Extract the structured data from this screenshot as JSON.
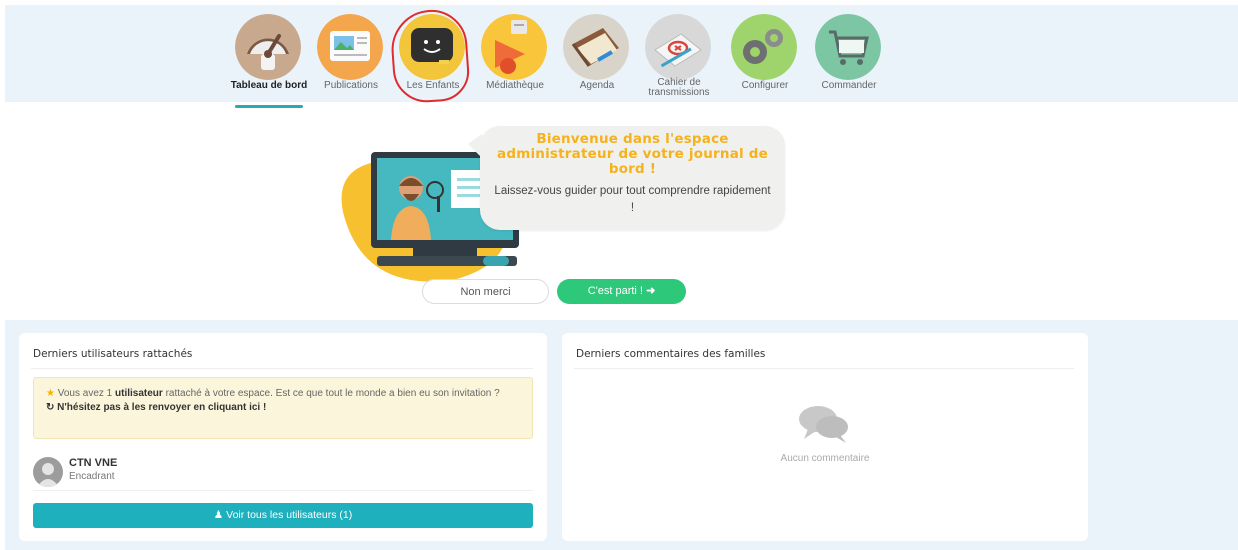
{
  "nav": {
    "items": [
      {
        "label": "Tableau de bord",
        "icon": "dashboard-gauge-icon",
        "active": true
      },
      {
        "label": "Publications",
        "icon": "publications-icon"
      },
      {
        "label": "Les Enfants",
        "icon": "children-icon",
        "highlighted": true
      },
      {
        "label": "Médiathèque",
        "icon": "media-library-icon"
      },
      {
        "label": "Agenda",
        "icon": "agenda-icon"
      },
      {
        "label": "Cahier de transmissions",
        "icon": "transmissions-notebook-icon"
      },
      {
        "label": "Configurer",
        "icon": "gears-icon"
      },
      {
        "label": "Commander",
        "icon": "shopping-cart-icon"
      }
    ],
    "accent_color": "#2aa9ae",
    "highlight_color": "#e02b2b"
  },
  "welcome": {
    "title": "Bienvenue dans l'espace administrateur de votre journal de bord !",
    "text": "Laissez-vous guider pour tout comprendre rapidement !",
    "decline_label": "Non merci",
    "accept_label": "C'est parti !",
    "accept_icon": "arrow-right-icon",
    "title_color": "#f6b21a",
    "accept_color": "#2ec87a"
  },
  "users_card": {
    "title": "Derniers utilisateurs rattachés",
    "notice_pre": "Vous avez 1",
    "notice_bold": "utilisateur",
    "notice_post": "rattaché à votre espace. Est ce que tout le monde a bien eu son invitation ?",
    "notice_cta": "N'hésitez pas à les renvoyer en cliquant ici !",
    "users": [
      {
        "name": "CTN VNE",
        "role": "Encadrant"
      }
    ],
    "see_all_label": "Voir tous les utilisateurs (1)",
    "see_all_color": "#1fb0be"
  },
  "comments_card": {
    "title": "Derniers commentaires des familles",
    "empty_text": "Aucun commentaire"
  }
}
